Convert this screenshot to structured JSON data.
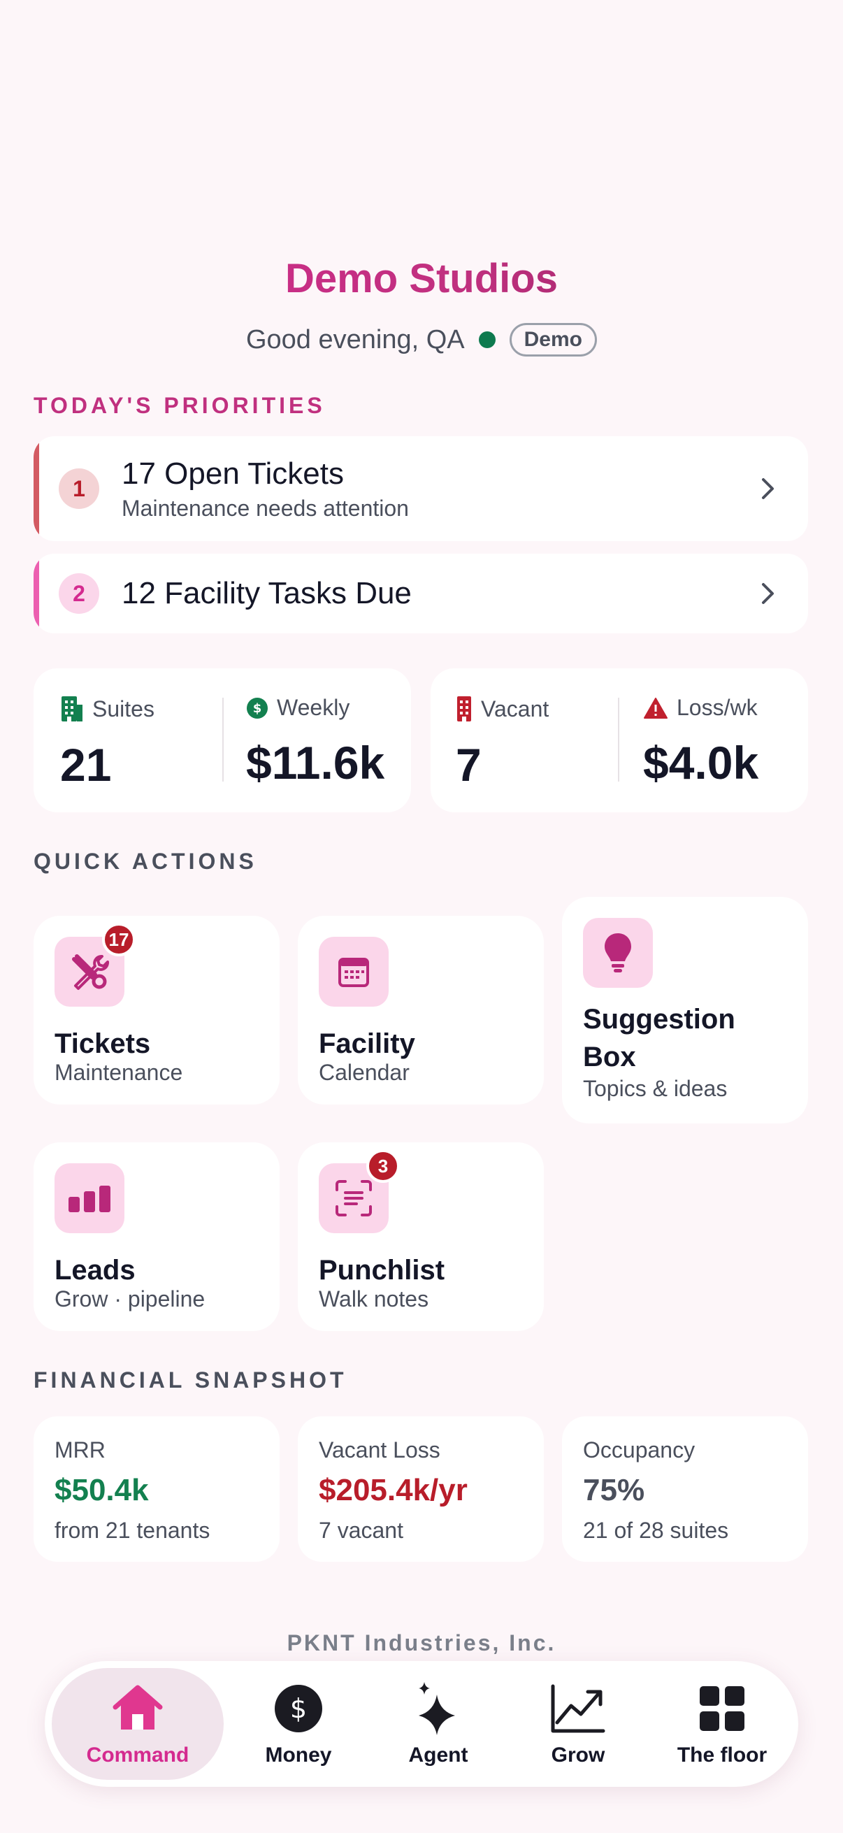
{
  "header": {
    "brand": "Demo Studios",
    "greeting": "Good evening, QA",
    "mode_badge": "Demo",
    "colors": {
      "brand": "#d42a8f",
      "online": "#0e7a4f"
    }
  },
  "priorities": {
    "label": "TODAY'S PRIORITIES",
    "items": [
      {
        "number": "1",
        "title": "17 Open Tickets",
        "subtitle": "Maintenance needs attention",
        "accent": "#d35a62",
        "icon": "chevron-right-icon"
      },
      {
        "number": "2",
        "title": "12 Facility Tasks Due",
        "subtitle": "",
        "accent": "#ec5fb0",
        "icon": "chevron-right-icon"
      }
    ]
  },
  "stats": [
    {
      "label": "Suites",
      "value": "21",
      "icon": "building-icon"
    },
    {
      "label": "Weekly",
      "value": "$11.6k",
      "icon": "dollar-circle-icon"
    },
    {
      "label": "Vacant",
      "value": "7",
      "icon": "building-red-icon"
    },
    {
      "label": "Loss/wk",
      "value": "$4.0k",
      "icon": "warning-icon"
    }
  ],
  "quick_actions": {
    "label": "QUICK ACTIONS",
    "items": [
      {
        "title": "Tickets",
        "subtitle": "Maintenance",
        "badge": "17",
        "icon": "tools-icon"
      },
      {
        "title": "Facility",
        "subtitle": "Calendar",
        "badge": "",
        "icon": "calendar-icon"
      },
      {
        "title_line1": "Suggestion",
        "title_line2": "Box",
        "subtitle": "Topics & ideas",
        "badge": "",
        "icon": "lightbulb-icon"
      },
      {
        "title": "Leads",
        "subtitle": "Grow · pipeline",
        "badge": "",
        "icon": "bar-chart-icon"
      },
      {
        "title": "Punchlist",
        "subtitle": "Walk notes",
        "badge": "3",
        "icon": "scan-text-icon"
      }
    ]
  },
  "financial": {
    "label": "FINANCIAL SNAPSHOT",
    "items": [
      {
        "label": "MRR",
        "value": "$50.4k",
        "sub": "from 21 tenants",
        "color": "#13804f"
      },
      {
        "label": "Vacant Loss",
        "value": "$205.4k/yr",
        "sub": "7 vacant",
        "color": "#b81d2a"
      },
      {
        "label": "Occupancy",
        "value": "75%",
        "sub": "21 of 28 suites",
        "color": "#4a4f5c"
      }
    ]
  },
  "footer": {
    "company": "PKNT Industries, Inc."
  },
  "nav": {
    "active": "Command",
    "tabs": [
      {
        "label": "Command",
        "icon": "home-icon"
      },
      {
        "label": "Money",
        "icon": "dollar-icon"
      },
      {
        "label": "Agent",
        "icon": "sparkle-icon"
      },
      {
        "label": "Grow",
        "icon": "trend-up-icon"
      },
      {
        "label": "The floor",
        "icon": "grid-icon"
      }
    ]
  }
}
